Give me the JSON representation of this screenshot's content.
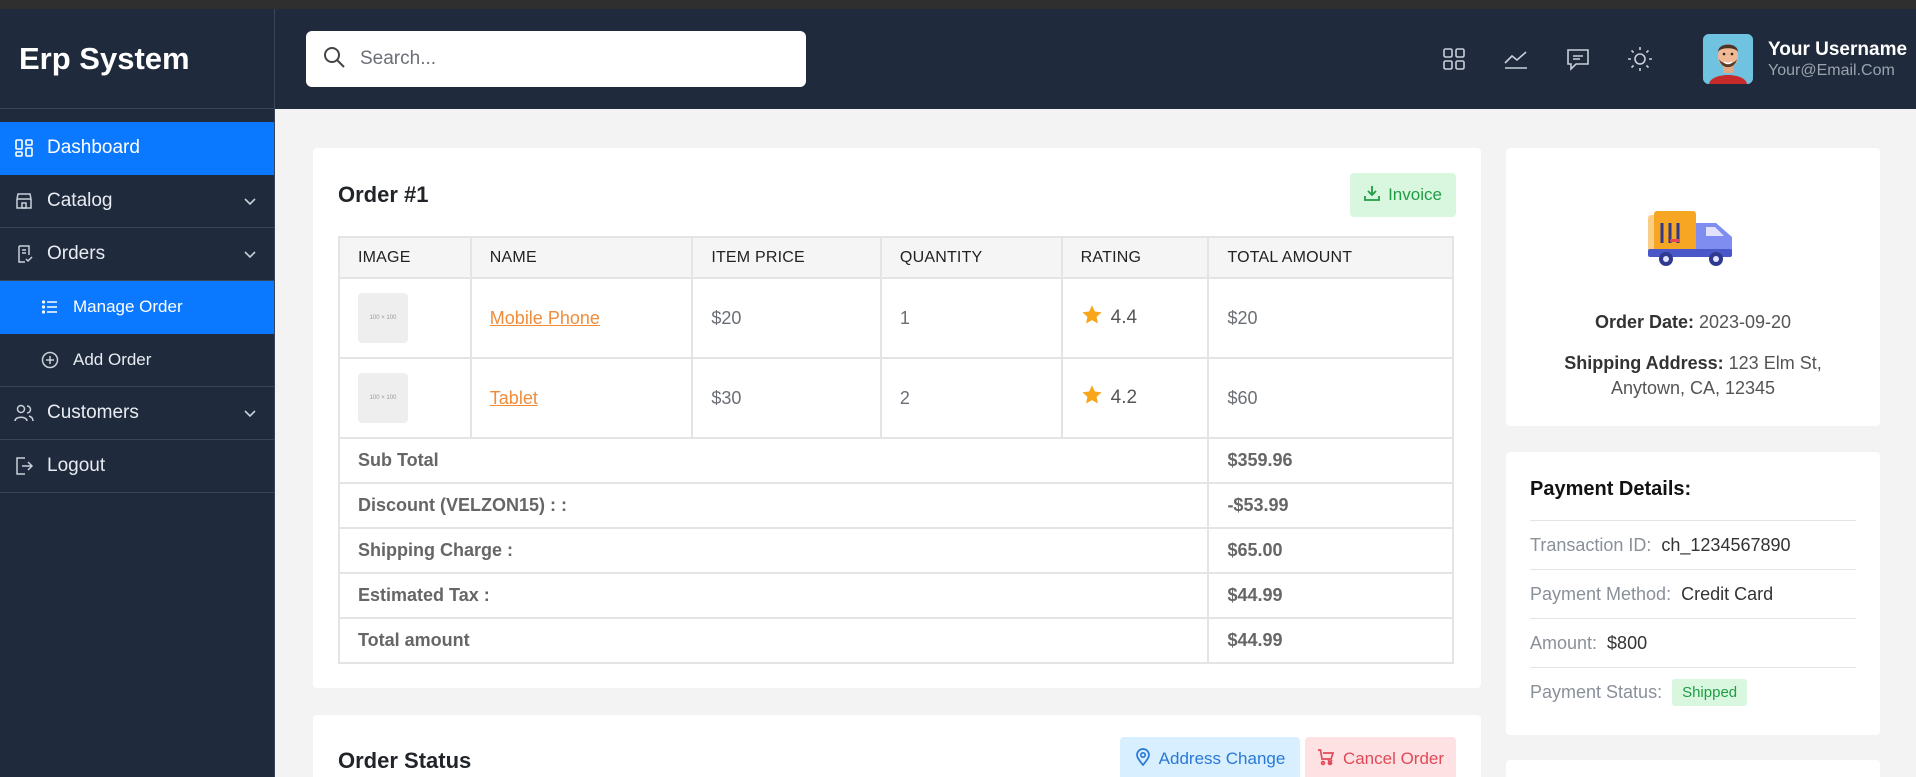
{
  "app": {
    "title": "Erp System"
  },
  "sidebar": {
    "items": [
      {
        "label": "Dashboard"
      },
      {
        "label": "Catalog"
      },
      {
        "label": "Orders"
      },
      {
        "label": "Manage Order"
      },
      {
        "label": "Add Order"
      },
      {
        "label": "Customers"
      },
      {
        "label": "Logout"
      }
    ]
  },
  "header": {
    "search_placeholder": "Search...",
    "icons": [
      "grid-icon",
      "chart-line-icon",
      "message-icon",
      "sun-icon"
    ],
    "user": {
      "name": "Your Username",
      "email": "Your@Email.Com"
    }
  },
  "order": {
    "title": "Order #1",
    "invoice_label": "Invoice",
    "columns": [
      "IMAGE",
      "NAME",
      "ITEM PRICE",
      "QUANTITY",
      "RATING",
      "TOTAL AMOUNT"
    ],
    "rows": [
      {
        "image_text": "100 × 100",
        "name": "Mobile Phone",
        "price": "$20",
        "quantity": "1",
        "rating": "4.4",
        "total": "$20"
      },
      {
        "image_text": "100 × 100",
        "name": "Tablet",
        "price": "$30",
        "quantity": "2",
        "rating": "4.2",
        "total": "$60"
      }
    ],
    "summary": [
      {
        "label": "Sub Total",
        "value": "$359.96"
      },
      {
        "label": "Discount (VELZON15) : :",
        "value": "-$53.99"
      },
      {
        "label": "Shipping Charge :",
        "value": "$65.00"
      },
      {
        "label": "Estimated Tax :",
        "value": "$44.99"
      },
      {
        "label": "Total amount",
        "value": "$44.99"
      }
    ]
  },
  "status": {
    "title": "Order Status",
    "address_change_label": "Address Change",
    "cancel_label": "Cancel Order"
  },
  "info": {
    "order_date_label": "Order Date:",
    "order_date": "2023-09-20",
    "shipping_label": "Shipping Address:",
    "shipping_address": "123 Elm St, Anytown, CA, 12345"
  },
  "payment": {
    "title": "Payment Details:",
    "transaction_label": "Transaction ID:",
    "transaction_id": "ch_1234567890",
    "method_label": "Payment Method:",
    "method": "Credit Card",
    "amount_label": "Amount:",
    "amount": "$800",
    "status_label": "Payment Status:",
    "status": "Shipped"
  },
  "colors": {
    "sidebar_bg": "#1f2a3c",
    "accent": "#0a78ff",
    "link": "#f08c3a",
    "success": "#1f9d45",
    "danger": "#e04a58"
  }
}
